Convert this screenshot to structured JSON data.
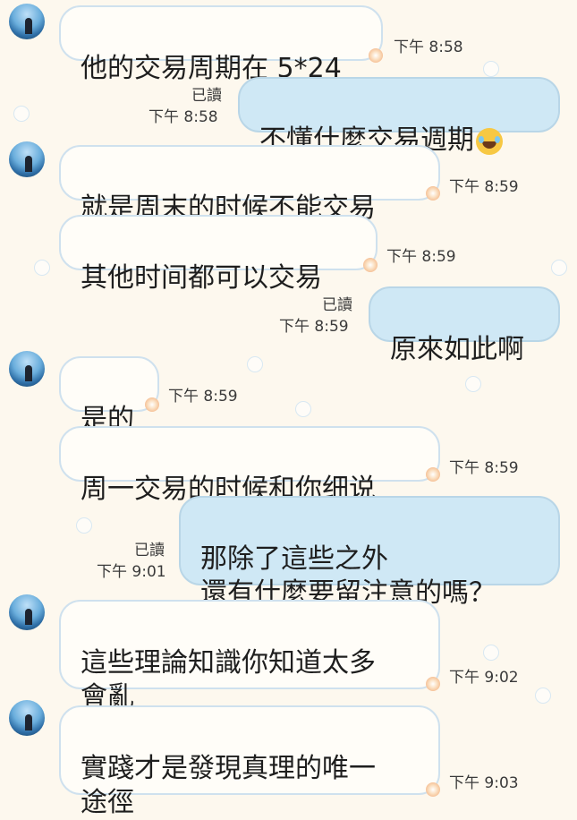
{
  "messages": [
    {
      "text": "他的交易周期在 5*24",
      "time": "下午 8:58"
    },
    {
      "read": "已讀",
      "text": "不懂什麼交易週期",
      "emoji_name": "tears-of-joy-emoji",
      "time": "下午 8:58"
    },
    {
      "text": "就是周末的时候不能交易",
      "time": "下午 8:59"
    },
    {
      "text": "其他时间都可以交易",
      "time": "下午 8:59"
    },
    {
      "read": "已讀",
      "text": "原來如此啊",
      "time": "下午 8:59"
    },
    {
      "text": "是的",
      "time": "下午 8:59"
    },
    {
      "text": "周一交易的时候和你细说",
      "time": "下午 8:59"
    },
    {
      "read": "已讀",
      "text": "那除了這些之外\n還有什麼要留注意的嗎？",
      "time": "下午 9:01"
    },
    {
      "text": "這些理論知識你知道太多\n會亂",
      "time": "下午 9:02"
    },
    {
      "text": "實踐才是發現真理的唯一\n途徑",
      "time": "下午 9:03"
    }
  ]
}
